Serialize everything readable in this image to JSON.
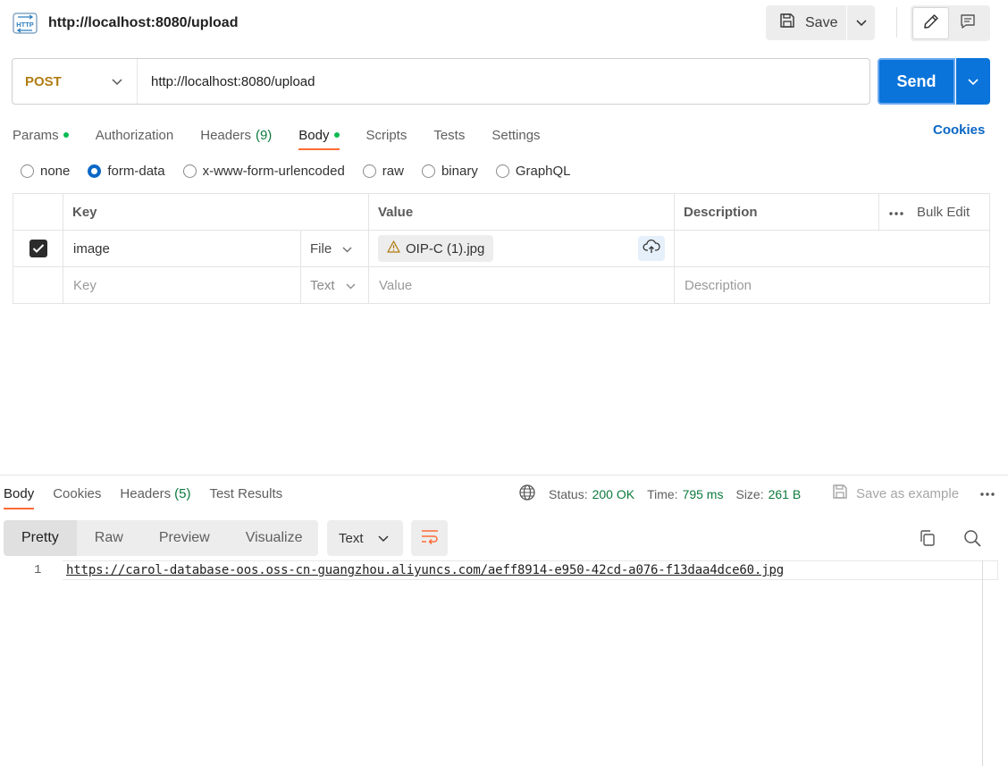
{
  "header": {
    "request_title": "http://localhost:8080/upload",
    "save_label": "Save"
  },
  "request": {
    "method": "POST",
    "url": "http://localhost:8080/upload",
    "send_label": "Send"
  },
  "request_tabs": {
    "params": "Params",
    "authorization": "Authorization",
    "headers": "Headers",
    "headers_count": "(9)",
    "body": "Body",
    "scripts": "Scripts",
    "tests": "Tests",
    "settings": "Settings",
    "cookies": "Cookies"
  },
  "body_types": {
    "none": "none",
    "form_data": "form-data",
    "urlencoded": "x-www-form-urlencoded",
    "raw": "raw",
    "binary": "binary",
    "graphql": "GraphQL",
    "selected": "form-data"
  },
  "params_table": {
    "headers": {
      "key": "Key",
      "value": "Value",
      "description": "Description",
      "bulk_edit": "Bulk Edit"
    },
    "rows": [
      {
        "checked": true,
        "key": "image",
        "type": "File",
        "value": "OIP-C (1).jpg",
        "description": ""
      }
    ],
    "new_row": {
      "key_placeholder": "Key",
      "type": "Text",
      "value_placeholder": "Value",
      "description_placeholder": "Description"
    }
  },
  "response": {
    "tabs": {
      "body": "Body",
      "cookies": "Cookies",
      "headers": "Headers",
      "headers_count": "(5)",
      "test_results": "Test Results"
    },
    "status_label": "Status:",
    "status_value": "200 OK",
    "time_label": "Time:",
    "time_value": "795 ms",
    "size_label": "Size:",
    "size_value": "261 B",
    "save_example": "Save as example",
    "views": {
      "pretty": "Pretty",
      "raw": "Raw",
      "preview": "Preview",
      "visualize": "Visualize"
    },
    "format": "Text",
    "lines": [
      {
        "number": "1",
        "text": "https://carol-database-oos.oss-cn-guangzhou.aliyuncs.com/aeff8914-e950-42cd-a076-f13daa4dce60.jpg"
      }
    ]
  },
  "colors": {
    "accent_orange": "#ff6c37",
    "send_blue": "#0a74da",
    "method_post": "#b07d13",
    "status_green": "#0d7a3e",
    "link_blue": "#0b67c5"
  },
  "icons": {
    "request_type": "http-icon",
    "save": "save-icon",
    "edit": "pencil-icon",
    "comments": "comment-icon",
    "warning": "warning-icon",
    "upload": "cloud-upload-icon",
    "network": "globe-icon",
    "copy": "copy-icon",
    "search": "search-icon",
    "wrap": "wrap-lines-icon"
  }
}
